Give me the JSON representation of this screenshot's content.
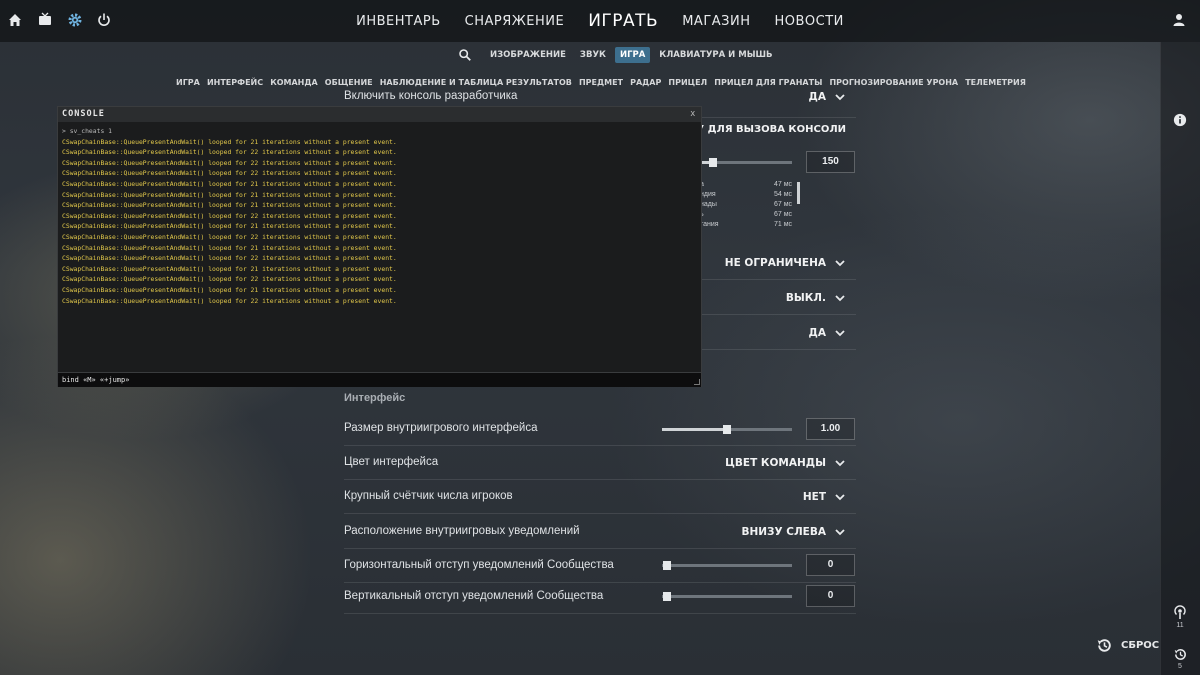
{
  "topbar": {
    "left_icons": [
      "home-icon",
      "tv-icon",
      "gear-icon",
      "power-icon"
    ],
    "nav": [
      "ИНВЕНТАРЬ",
      "СНАРЯЖЕНИЕ",
      "ИГРАТЬ",
      "МАГАЗИН",
      "НОВОСТИ"
    ],
    "active_nav": "ИГРАТЬ",
    "right_icon": "user-icon"
  },
  "subnav": {
    "items": [
      "ИЗОБРАЖЕНИЕ",
      "ЗВУК",
      "ИГРА",
      "КЛАВИАТУРА И МЫШЬ"
    ],
    "active": "ИГРА"
  },
  "tabs": [
    "ИГРА",
    "ИНТЕРФЕЙС",
    "КОМАНДА",
    "ОБЩЕНИЕ",
    "НАБЛЮДЕНИЕ И ТАБЛИЦА РЕЗУЛЬТАТОВ",
    "ПРЕДМЕТ",
    "РАДАР",
    "ПРИЦЕЛ",
    "ПРИЦЕЛ ДЛЯ ГРАНАТЫ",
    "ПРОГНОЗИРОВАНИЕ УРОНА",
    "ТЕЛЕМЕТРИЯ"
  ],
  "settings": {
    "partial_top": {
      "label": "Включить консоль разработчика",
      "value": "ДА",
      "keybind_label": "Ь КЛАВИШУ ДЛЯ ВЫЗОВА КОНСОЛИ",
      "slider_value": "150",
      "latency": [
        {
          "label": "а",
          "value": "47 мс"
        },
        {
          "label": "ндия",
          "value": "54 мс"
        },
        {
          "label": "нады",
          "value": "67 мс"
        },
        {
          "label": "ь",
          "value": "67 мс"
        },
        {
          "label": "тания",
          "value": "71 мс"
        }
      ],
      "dropdowns": [
        "НЕ ОГРАНИЧЕНА",
        "ВЫКЛ.",
        "ДА"
      ]
    },
    "interface": {
      "title": "Интерфейс",
      "rows": [
        {
          "label": "Размер внутриигрового интерфейса",
          "type": "slider",
          "value": "1.00",
          "level": 0.5
        },
        {
          "label": "Цвет интерфейса",
          "type": "dropdown",
          "value": "ЦВЕТ КОМАНДЫ"
        },
        {
          "label": "Крупный счётчик числа игроков",
          "type": "dropdown",
          "value": "НЕТ"
        },
        {
          "label": "Расположение внутриигровых уведомлений",
          "type": "dropdown",
          "value": "ВНИЗУ СЛЕВА"
        },
        {
          "label": "Горизонтальный отступ уведомлений Сообщества",
          "type": "slider",
          "value": "0",
          "level": 0.0
        },
        {
          "label": "Вертикальный отступ уведомлений Сообщества",
          "type": "slider",
          "value": "0",
          "level": 0.0
        }
      ]
    }
  },
  "console": {
    "title": "CONSOLE",
    "close": "x",
    "command_echo": "> sv_cheats 1",
    "lines": [
      "CSwapChainBase::QueuePresentAndWait() looped for 21 iterations without a present event.",
      "CSwapChainBase::QueuePresentAndWait() looped for 22 iterations without a present event.",
      "CSwapChainBase::QueuePresentAndWait() looped for 22 iterations without a present event.",
      "CSwapChainBase::QueuePresentAndWait() looped for 22 iterations without a present event.",
      "CSwapChainBase::QueuePresentAndWait() looped for 21 iterations without a present event.",
      "CSwapChainBase::QueuePresentAndWait() looped for 21 iterations without a present event.",
      "CSwapChainBase::QueuePresentAndWait() looped for 21 iterations without a present event.",
      "CSwapChainBase::QueuePresentAndWait() looped for 22 iterations without a present event.",
      "CSwapChainBase::QueuePresentAndWait() looped for 21 iterations without a present event.",
      "CSwapChainBase::QueuePresentAndWait() looped for 22 iterations without a present event.",
      "CSwapChainBase::QueuePresentAndWait() looped for 21 iterations without a present event.",
      "CSwapChainBase::QueuePresentAndWait() looped for 22 iterations without a present event.",
      "CSwapChainBase::QueuePresentAndWait() looped for 21 iterations without a present event.",
      "CSwapChainBase::QueuePresentAndWait() looped for 22 iterations without a present event.",
      "CSwapChainBase::QueuePresentAndWait() looped for 21 iterations without a present event.",
      "CSwapChainBase::QueuePresentAndWait() looped for 22 iterations without a present event."
    ],
    "input_value": "bind «M» «+jump»"
  },
  "rightbar": {
    "info_icon": "info-icon",
    "broadcast_count": "11",
    "history_count": "5"
  },
  "reset": {
    "label": "СБРОС"
  },
  "colors": {
    "accent": "#3d6f8e",
    "console_text": "#e2c84a"
  }
}
